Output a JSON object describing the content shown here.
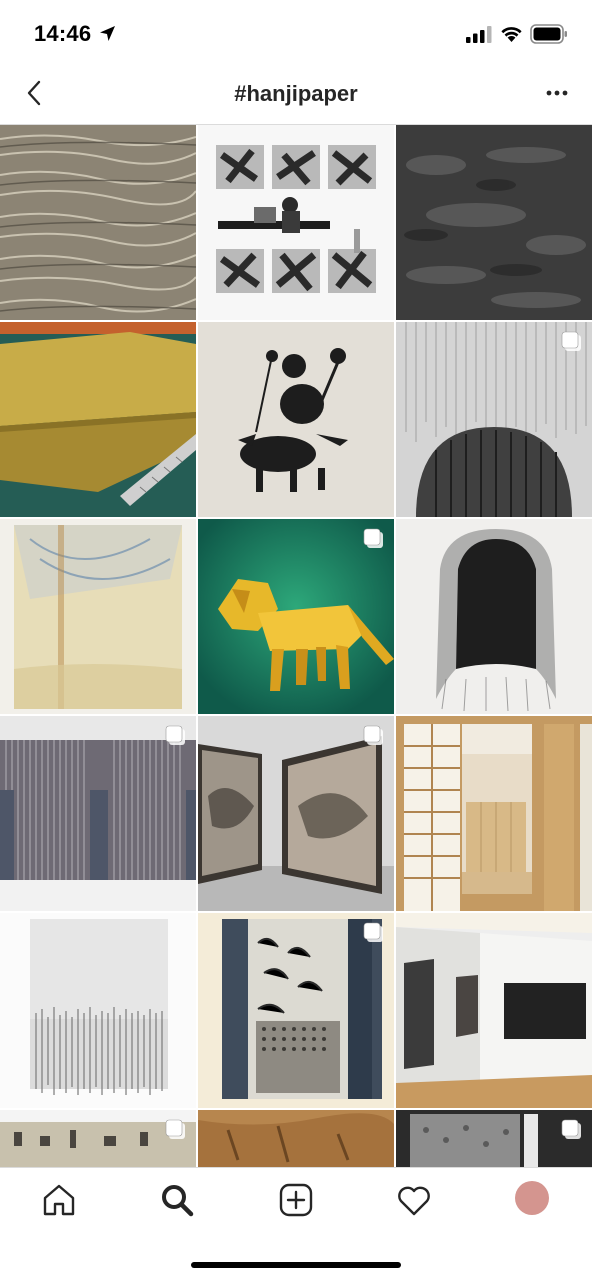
{
  "status_bar": {
    "time": "14:46"
  },
  "header": {
    "title": "#hanjipaper"
  },
  "grid": {
    "tiles": [
      {
        "subject": "bundled dry fibers",
        "multiple": false
      },
      {
        "subject": "artist at desk among prints",
        "multiple": false
      },
      {
        "subject": "dark textured paper",
        "multiple": false
      },
      {
        "subject": "yellow paper-covered box with ruler",
        "multiple": false
      },
      {
        "subject": "ink figure on paper",
        "multiple": false
      },
      {
        "subject": "gray striated paper",
        "multiple": true
      },
      {
        "subject": "stained pale sheet",
        "multiple": false
      },
      {
        "subject": "yellow origami lion on green",
        "multiple": true
      },
      {
        "subject": "black ink arch on paper",
        "multiple": false
      },
      {
        "subject": "striped panels on wall",
        "multiple": true
      },
      {
        "subject": "two framed gray works",
        "multiple": true
      },
      {
        "subject": "sliding paper door interior",
        "multiple": false
      },
      {
        "subject": "white paper with drip edge",
        "multiple": false
      },
      {
        "subject": "textile strips collage",
        "multiple": true
      },
      {
        "subject": "gallery with dark canvases",
        "multiple": false
      },
      {
        "subject": "script on paper strips",
        "multiple": true
      },
      {
        "subject": "brown tinted paper",
        "multiple": false
      },
      {
        "subject": "dark textured block",
        "multiple": true
      }
    ]
  },
  "tab_bar": {
    "items": [
      "home",
      "search",
      "create",
      "activity",
      "profile"
    ],
    "active": "search"
  },
  "colors": {
    "avatar": "#d4958f",
    "divider": "#dbdbdb",
    "text": "#262626"
  }
}
